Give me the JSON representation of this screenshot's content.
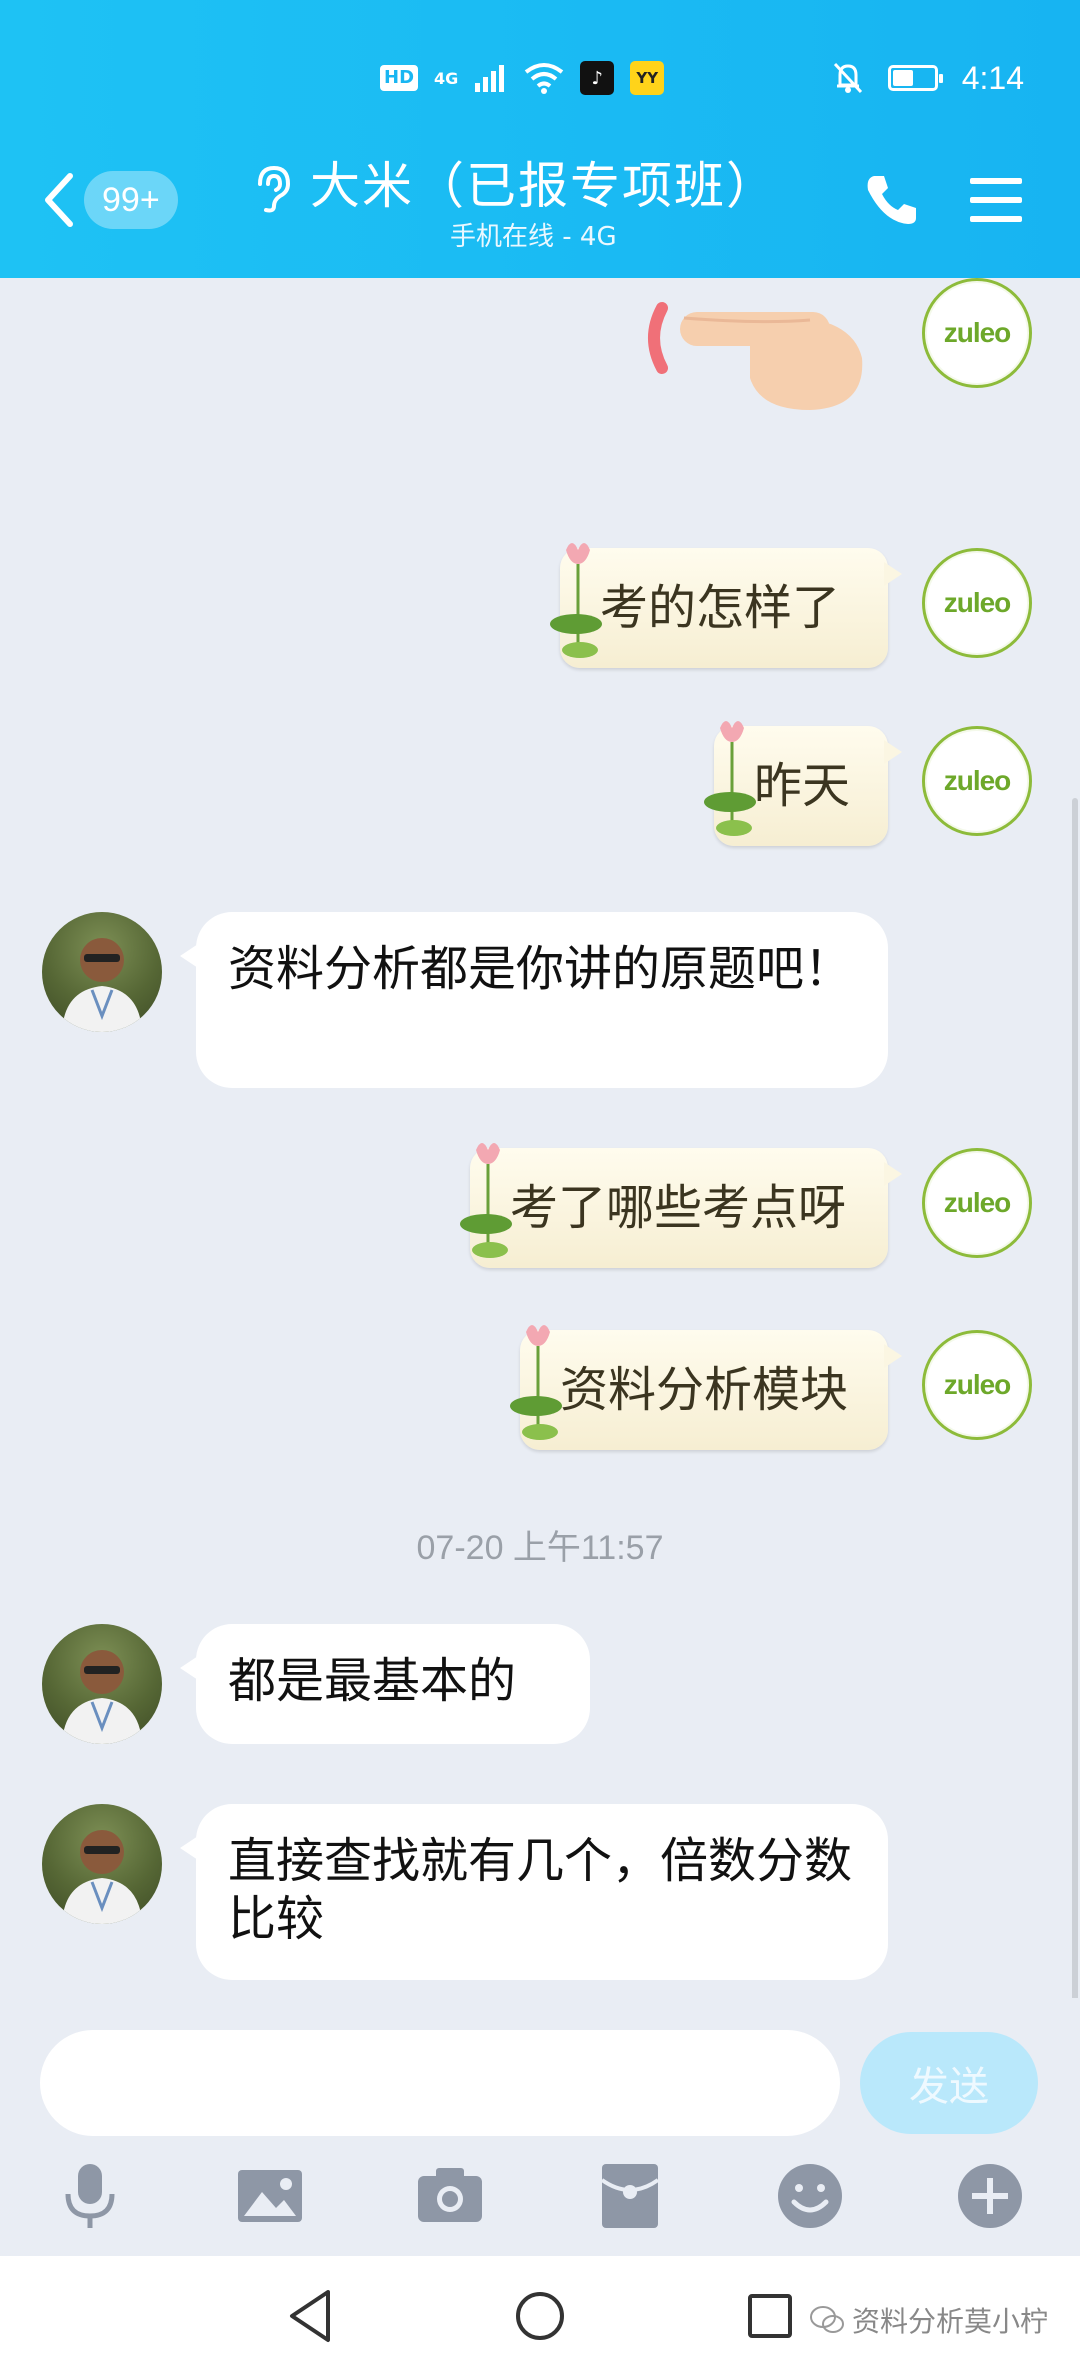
{
  "status_bar": {
    "hd": "HD",
    "network": "4G",
    "time": "4:14",
    "battery_level": 0.5,
    "app_badges": [
      "tiktok-icon",
      "yy-icon"
    ]
  },
  "header": {
    "back_count": "99+",
    "title": "大米（已报专项班）",
    "subtitle": "手机在线 - 4G",
    "accent_color": "#1ec2f4"
  },
  "self_avatar_text": "zuleo",
  "messages": [
    {
      "side": "right",
      "type": "emoji",
      "emoji": "pointing-hand"
    },
    {
      "side": "right",
      "text": "考的怎样了"
    },
    {
      "side": "right",
      "text": "昨天"
    },
    {
      "side": "left",
      "text": "资料分析都是你讲的原题吧！"
    },
    {
      "side": "right",
      "text": "考了哪些考点呀"
    },
    {
      "side": "right",
      "text": "资料分析模块"
    },
    {
      "side": "left",
      "text": "都是最基本的"
    },
    {
      "side": "left",
      "text": "直接查找就有几个，倍数分数比较"
    }
  ],
  "timestamp": "07-20 上午11:57",
  "input": {
    "value": "",
    "placeholder": "",
    "send_label": "发送"
  },
  "toolbar": [
    "mic-icon",
    "image-icon",
    "camera-icon",
    "red-packet-icon",
    "emoji-icon",
    "plus-icon"
  ],
  "watermark": "资料分析莫小柠"
}
